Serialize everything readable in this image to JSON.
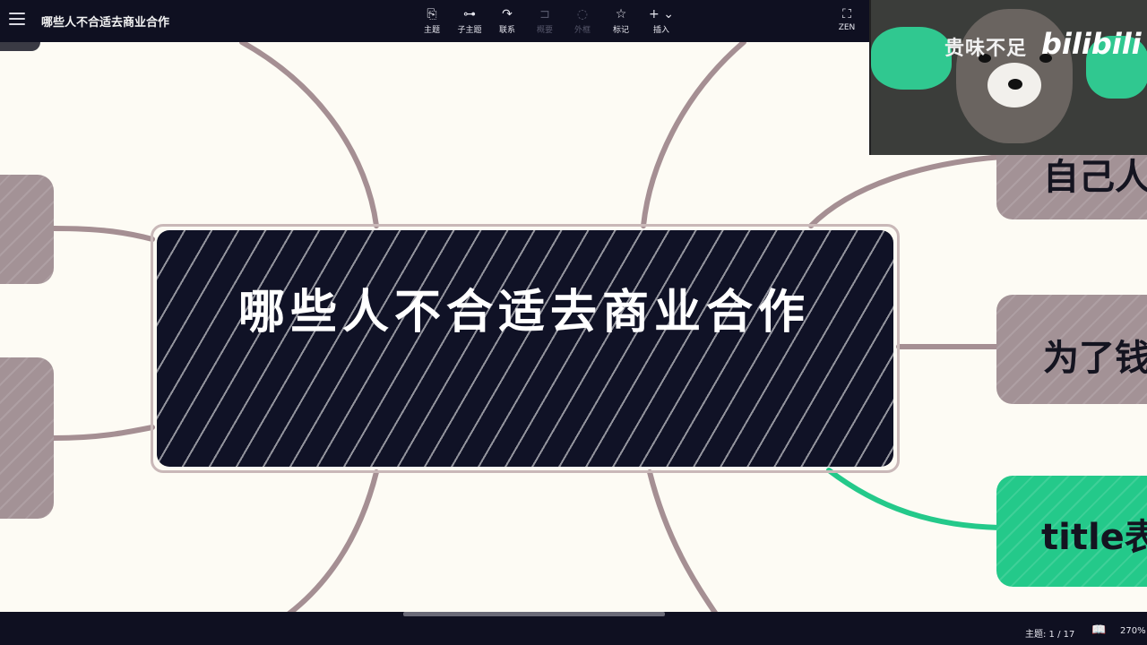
{
  "app": {
    "document_title": "哪些人不合适去商业合作"
  },
  "toolbar": {
    "items": [
      {
        "label": "主题",
        "icon": "topic-icon",
        "enabled": true
      },
      {
        "label": "子主题",
        "icon": "subtopic-icon",
        "enabled": true
      },
      {
        "label": "联系",
        "icon": "relationship-icon",
        "enabled": true
      },
      {
        "label": "概要",
        "icon": "summary-icon",
        "enabled": false
      },
      {
        "label": "外框",
        "icon": "boundary-icon",
        "enabled": false
      },
      {
        "label": "标记",
        "icon": "star-icon",
        "enabled": true
      },
      {
        "label": "插入",
        "icon": "plus-icon",
        "enabled": true
      }
    ],
    "zen_label": "ZEN"
  },
  "mindmap": {
    "central_topic": "哪些人不合适去商业合作",
    "branches_right": [
      {
        "label": "自己人",
        "color": "#a39296"
      },
      {
        "label": "为了钱",
        "color": "#a39296"
      },
      {
        "label": "title表",
        "color": "#24c98a"
      }
    ]
  },
  "webcam": {
    "watermark_text": "贵味不足",
    "brand": "bilibili"
  },
  "statusbar": {
    "topic_count": "主题: 1 / 17",
    "zoom": "270%"
  },
  "colors": {
    "toolbar_bg": "#0f1021",
    "canvas_bg": "#fdfbf4",
    "central_bg": "#101226",
    "branch_grey": "#a39296",
    "branch_green": "#24c98a",
    "connector": "#a58f93"
  }
}
